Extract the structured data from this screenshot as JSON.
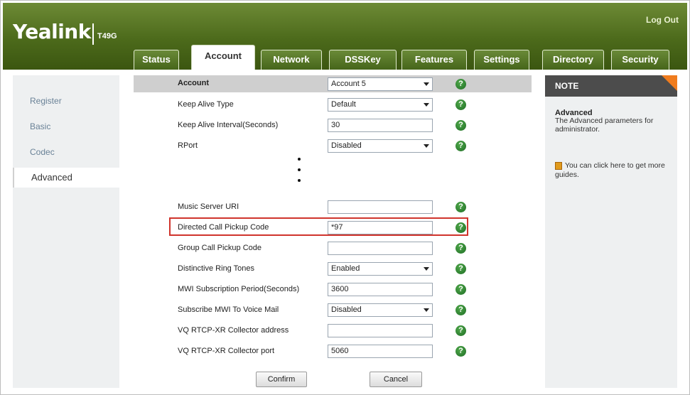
{
  "header": {
    "logo": "Yealink",
    "model": "T49G",
    "logout": "Log Out"
  },
  "tabs": [
    {
      "label": "Status"
    },
    {
      "label": "Account"
    },
    {
      "label": "Network"
    },
    {
      "label": "DSSKey"
    },
    {
      "label": "Features"
    },
    {
      "label": "Settings"
    },
    {
      "label": "Directory"
    },
    {
      "label": "Security"
    }
  ],
  "active_tab": "Account",
  "sidebar": {
    "items": [
      {
        "label": "Register"
      },
      {
        "label": "Basic"
      },
      {
        "label": "Codec"
      },
      {
        "label": "Advanced"
      }
    ],
    "active": "Advanced"
  },
  "form": {
    "account_label": "Account",
    "account_value": "Account 5",
    "rows_top": [
      {
        "label": "Keep Alive Type",
        "value": "Default",
        "type": "select"
      },
      {
        "label": "Keep Alive Interval(Seconds)",
        "value": "30",
        "type": "input"
      },
      {
        "label": "RPort",
        "value": "Disabled",
        "type": "select"
      }
    ],
    "rows_bottom": [
      {
        "label": "Music Server URI",
        "value": "",
        "type": "input"
      },
      {
        "label": "Directed Call Pickup Code",
        "value": "*97",
        "type": "input"
      },
      {
        "label": "Group Call Pickup Code",
        "value": "",
        "type": "input"
      },
      {
        "label": "Distinctive Ring Tones",
        "value": "Enabled",
        "type": "select"
      },
      {
        "label": "MWI Subscription Period(Seconds)",
        "value": "3600",
        "type": "input"
      },
      {
        "label": "Subscribe MWI To Voice Mail",
        "value": "Disabled",
        "type": "select"
      },
      {
        "label": "VQ RTCP-XR Collector address",
        "value": "",
        "type": "input"
      },
      {
        "label": "VQ RTCP-XR Collector port",
        "value": "5060",
        "type": "input"
      }
    ],
    "help_glyph": "?",
    "confirm": "Confirm",
    "cancel": "Cancel"
  },
  "note": {
    "heading": "NOTE",
    "title": "Advanced",
    "text": "The Advanced parameters for administrator.",
    "guide": "You can click here to get more guides."
  },
  "colors": {
    "header_green": "#4c6a1b",
    "highlight_red": "#d0342c",
    "note_accent": "#f07c1e",
    "help_green": "#1f6d25"
  },
  "icons": {
    "help": "question-circle-icon",
    "guide": "book-icon",
    "dropdown": "chevron-down-icon"
  }
}
